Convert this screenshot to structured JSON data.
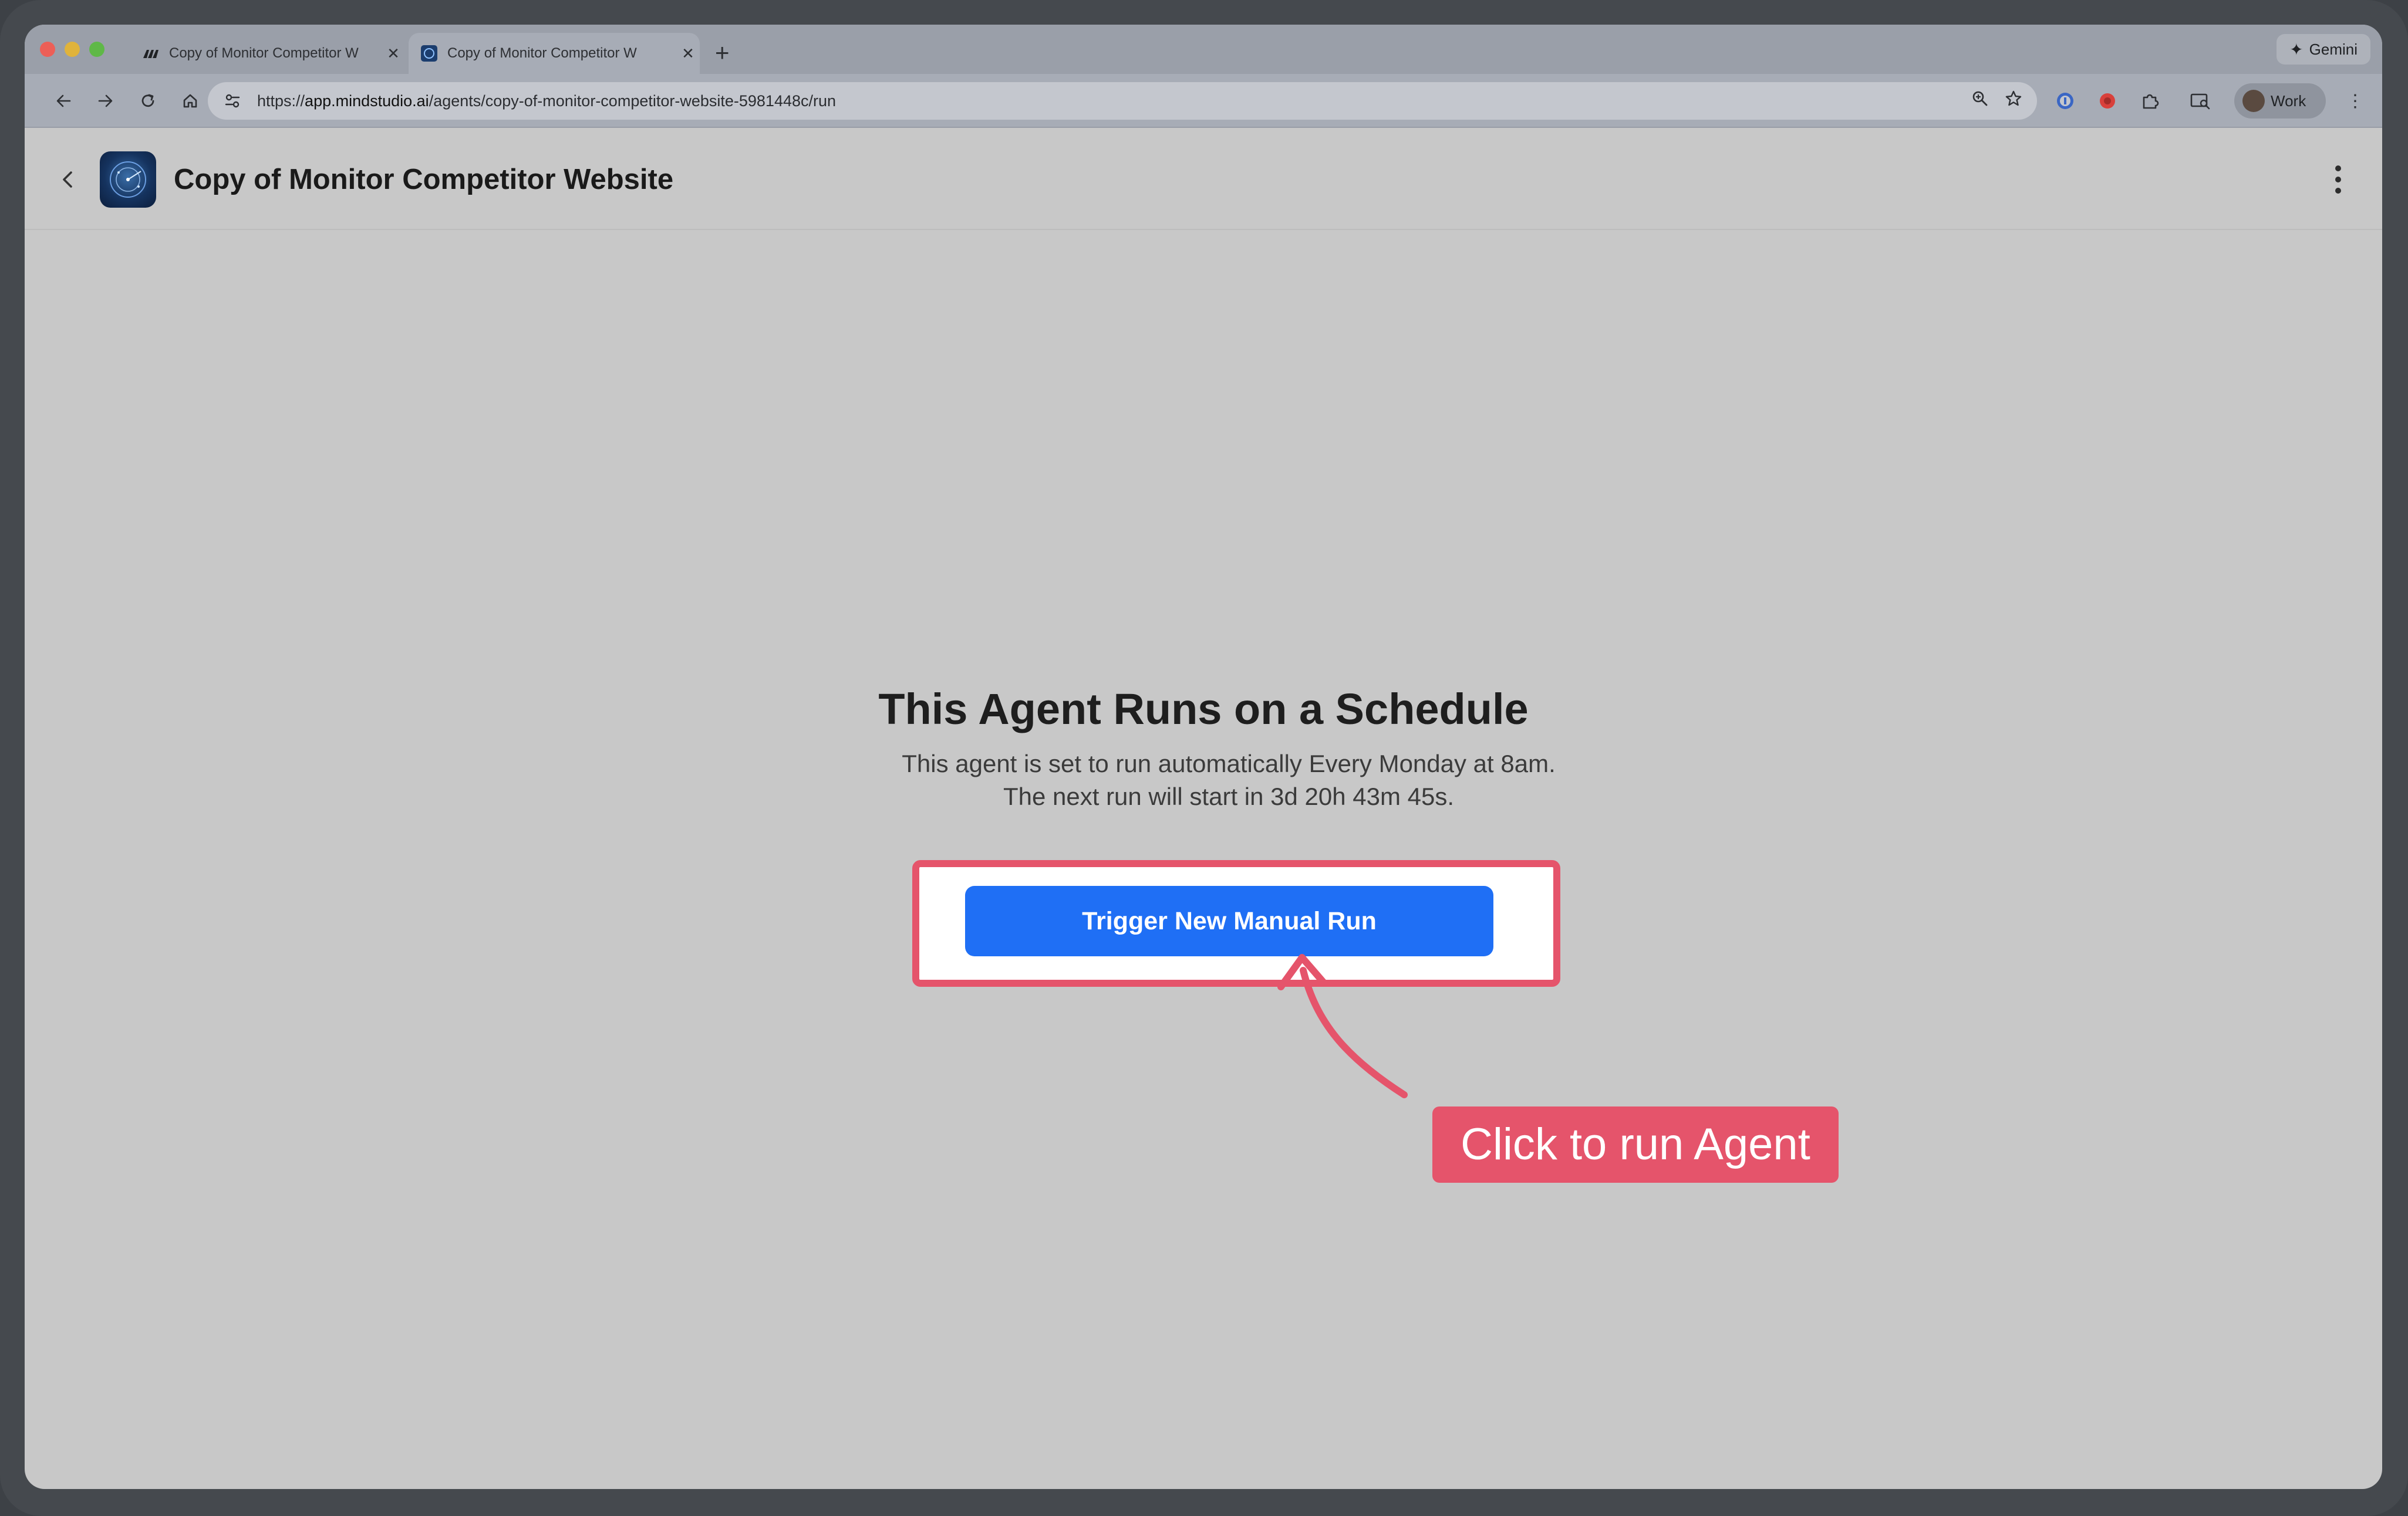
{
  "browser": {
    "tabs": [
      {
        "title": "Copy of Monitor Competitor W",
        "active": false
      },
      {
        "title": "Copy of Monitor Competitor W",
        "active": true
      }
    ],
    "new_tab_label": "+",
    "gemini_label": "Gemini",
    "url_prefix": "https://",
    "url_host": "app.mindstudio.ai",
    "url_path": "/agents/copy-of-monitor-competitor-website-5981448c/run",
    "profile_label": "Work"
  },
  "app": {
    "title": "Copy of Monitor Competitor Website"
  },
  "main": {
    "heading": "This Agent Runs on a Schedule",
    "description": "This agent is set to run automatically Every Monday at 8am. The next run will start in 3d 20h 43m 45s.",
    "run_button_label": "Trigger New Manual Run"
  },
  "annotation": {
    "callout_text": "Click to run Agent",
    "color": "#e5546b"
  },
  "colors": {
    "primary_button": "#1f6ff5",
    "page_background": "#c8c8c8"
  }
}
